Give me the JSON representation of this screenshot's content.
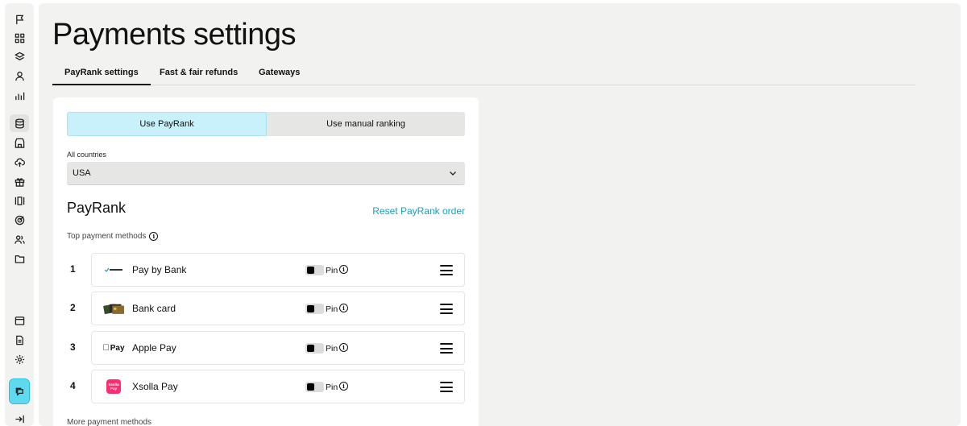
{
  "page": {
    "title": "Payments settings"
  },
  "tabs": [
    {
      "label": "PayRank settings",
      "active": true
    },
    {
      "label": "Fast & fair refunds",
      "active": false
    },
    {
      "label": "Gateways",
      "active": false
    }
  ],
  "mode_toggle": {
    "payrank_label": "Use PayRank",
    "manual_label": "Use manual ranking",
    "selected": "payrank"
  },
  "country": {
    "label": "All countries",
    "value": "USA"
  },
  "payrank": {
    "title": "PayRank",
    "reset_label": "Reset PayRank order",
    "top_label": "Top payment methods",
    "more_label": "More payment methods",
    "pin_label": "Pin",
    "methods": [
      {
        "rank": "1",
        "name": "Pay by Bank",
        "logo": "open-banking-logo"
      },
      {
        "rank": "2",
        "name": "Bank card",
        "logo": "cards-logo"
      },
      {
        "rank": "3",
        "name": "Apple Pay",
        "logo": "apple-pay-logo",
        "logo_text": "Pay"
      },
      {
        "rank": "4",
        "name": "Xsolla Pay",
        "logo": "xsolla-pay-logo",
        "logo_text": "Xsolla Pay"
      }
    ]
  },
  "colors": {
    "accent": "#1a9fba",
    "selected_segment": "#c8f1fb",
    "sidebar_highlight": "#5ed9f0",
    "xsolla_pink": "#ff2d6f"
  }
}
